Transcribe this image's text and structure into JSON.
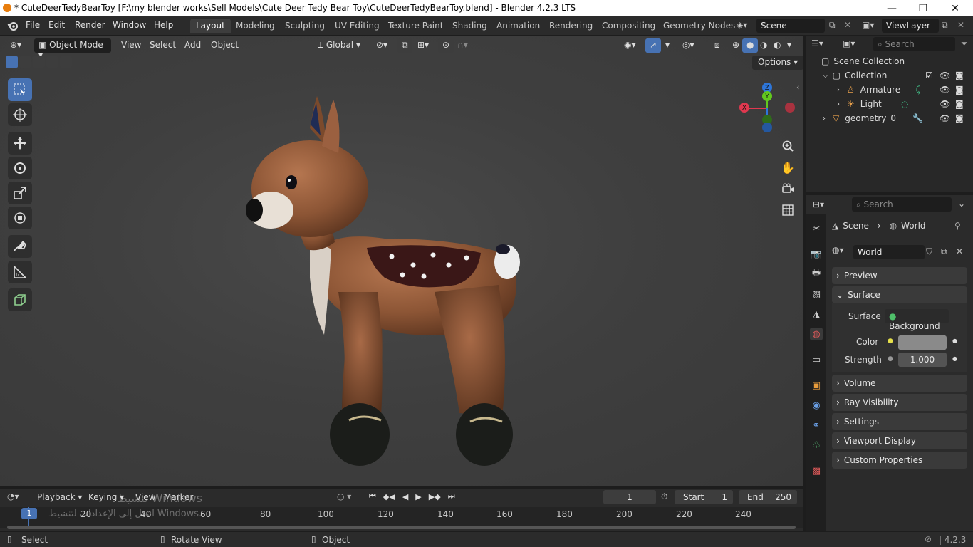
{
  "window": {
    "title": "* CuteDeerTedyBearToy [F:\\my blender works\\Sell Models\\Cute Deer Tedy Bear Toy\\CuteDeerTedyBearToy.blend] - Blender 4.2.3 LTS",
    "minimize": "—",
    "maximize": "❐",
    "close": "✕"
  },
  "menu": [
    "File",
    "Edit",
    "Render",
    "Window",
    "Help"
  ],
  "workspaces": [
    "Layout",
    "Modeling",
    "Sculpting",
    "UV Editing",
    "Texture Paint",
    "Shading",
    "Animation",
    "Rendering",
    "Compositing",
    "Geometry Nodes"
  ],
  "active_workspace": "Layout",
  "scene_field": "Scene",
  "viewlayer_field": "ViewLayer",
  "viewport_header": {
    "mode": "Object Mode",
    "menus": [
      "View",
      "Select",
      "Add",
      "Object"
    ],
    "orientation": "Global",
    "options": "Options"
  },
  "gizmo": {
    "x": "X",
    "y": "Y",
    "z": "Z"
  },
  "outliner": {
    "search_placeholder": "Search",
    "root": "Scene Collection",
    "collection": "Collection",
    "items": [
      "Armature",
      "Light",
      "geometry_0"
    ]
  },
  "properties": {
    "search_placeholder": "Search",
    "breadcrumb_scene": "Scene",
    "breadcrumb_world": "World",
    "world_name": "World",
    "panels": {
      "preview": "Preview",
      "surface": "Surface",
      "volume": "Volume",
      "ray_visibility": "Ray Visibility",
      "settings": "Settings",
      "viewport_display": "Viewport Display",
      "custom_properties": "Custom Properties"
    },
    "surface_label": "Surface",
    "surface_value": "Background",
    "color_label": "Color",
    "color_value": "#8a8a8a",
    "strength_label": "Strength",
    "strength_value": "1.000"
  },
  "timeline": {
    "menus": [
      "Playback",
      "Keying",
      "View",
      "Marker"
    ],
    "current_frame": "1",
    "start_label": "Start",
    "start_value": "1",
    "end_label": "End",
    "end_value": "250",
    "ruler": [
      "20",
      "40",
      "60",
      "80",
      "100",
      "120",
      "140",
      "160",
      "180",
      "200",
      "220",
      "240"
    ],
    "playhead": "1",
    "watermark_line1": "تنشيط Windows",
    "watermark_line2": "انتقل إلى الإعدادات لتنشيط Windows."
  },
  "status_bar": {
    "select": "Select",
    "rotate": "Rotate View",
    "object": "Object",
    "version": "4.2.3"
  },
  "colors": {
    "accent": "#4772b3",
    "gizmo_x": "#e0384f",
    "gizmo_y": "#62c81e",
    "gizmo_z": "#2e76d9"
  }
}
